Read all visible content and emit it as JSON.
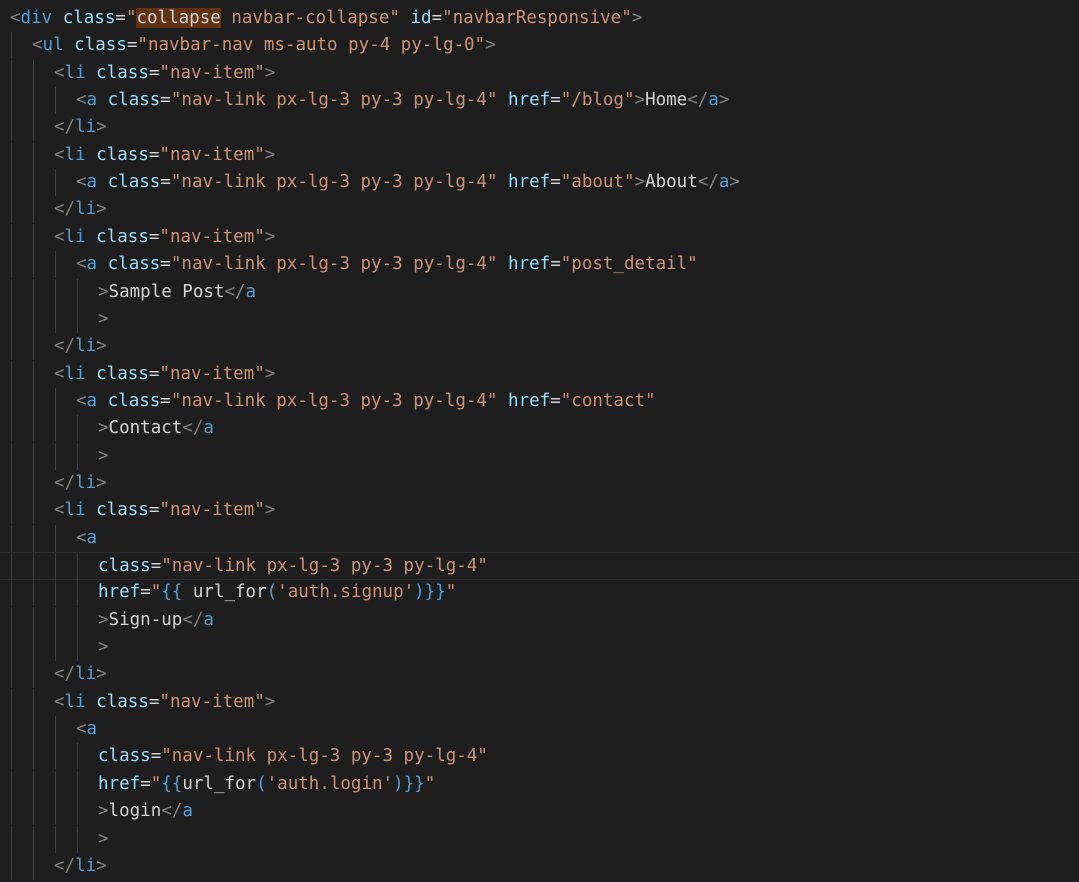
{
  "editor": {
    "language": "html",
    "theme": "dark",
    "lines": [
      {
        "indent": 0,
        "tokens": [
          [
            "b",
            "<"
          ],
          [
            "t",
            "div"
          ],
          [
            "tx",
            " "
          ],
          [
            "a",
            "class"
          ],
          [
            "tx",
            "="
          ],
          [
            "s",
            "\""
          ],
          [
            "sel",
            "collapse"
          ],
          [
            "s",
            " navbar-collapse\""
          ],
          [
            "tx",
            " "
          ],
          [
            "a",
            "id"
          ],
          [
            "tx",
            "="
          ],
          [
            "s",
            "\"navbarResponsive\""
          ],
          [
            "b",
            ">"
          ]
        ]
      },
      {
        "indent": 1,
        "tokens": [
          [
            "b",
            "<"
          ],
          [
            "t",
            "ul"
          ],
          [
            "tx",
            " "
          ],
          [
            "a",
            "class"
          ],
          [
            "tx",
            "="
          ],
          [
            "s",
            "\"navbar-nav ms-auto py-4 py-lg-0\""
          ],
          [
            "b",
            ">"
          ]
        ]
      },
      {
        "indent": 2,
        "tokens": [
          [
            "b",
            "<"
          ],
          [
            "t",
            "li"
          ],
          [
            "tx",
            " "
          ],
          [
            "a",
            "class"
          ],
          [
            "tx",
            "="
          ],
          [
            "s",
            "\"nav-item\""
          ],
          [
            "b",
            ">"
          ]
        ]
      },
      {
        "indent": 3,
        "tokens": [
          [
            "b",
            "<"
          ],
          [
            "t",
            "a"
          ],
          [
            "tx",
            " "
          ],
          [
            "a",
            "class"
          ],
          [
            "tx",
            "="
          ],
          [
            "s",
            "\"nav-link px-lg-3 py-3 py-lg-4\""
          ],
          [
            "tx",
            " "
          ],
          [
            "a",
            "href"
          ],
          [
            "tx",
            "="
          ],
          [
            "s",
            "\"/blog\""
          ],
          [
            "b",
            ">"
          ],
          [
            "tx",
            "Home"
          ],
          [
            "b",
            "</"
          ],
          [
            "t",
            "a"
          ],
          [
            "b",
            ">"
          ]
        ]
      },
      {
        "indent": 2,
        "tokens": [
          [
            "b",
            "</"
          ],
          [
            "t",
            "li"
          ],
          [
            "b",
            ">"
          ]
        ]
      },
      {
        "indent": 2,
        "tokens": [
          [
            "b",
            "<"
          ],
          [
            "t",
            "li"
          ],
          [
            "tx",
            " "
          ],
          [
            "a",
            "class"
          ],
          [
            "tx",
            "="
          ],
          [
            "s",
            "\"nav-item\""
          ],
          [
            "b",
            ">"
          ]
        ]
      },
      {
        "indent": 3,
        "tokens": [
          [
            "b",
            "<"
          ],
          [
            "t",
            "a"
          ],
          [
            "tx",
            " "
          ],
          [
            "a",
            "class"
          ],
          [
            "tx",
            "="
          ],
          [
            "s",
            "\"nav-link px-lg-3 py-3 py-lg-4\""
          ],
          [
            "tx",
            " "
          ],
          [
            "a",
            "href"
          ],
          [
            "tx",
            "="
          ],
          [
            "s",
            "\"about\""
          ],
          [
            "b",
            ">"
          ],
          [
            "tx",
            "About"
          ],
          [
            "b",
            "</"
          ],
          [
            "t",
            "a"
          ],
          [
            "b",
            ">"
          ]
        ]
      },
      {
        "indent": 2,
        "tokens": [
          [
            "b",
            "</"
          ],
          [
            "t",
            "li"
          ],
          [
            "b",
            ">"
          ]
        ]
      },
      {
        "indent": 2,
        "tokens": [
          [
            "b",
            "<"
          ],
          [
            "t",
            "li"
          ],
          [
            "tx",
            " "
          ],
          [
            "a",
            "class"
          ],
          [
            "tx",
            "="
          ],
          [
            "s",
            "\"nav-item\""
          ],
          [
            "b",
            ">"
          ]
        ]
      },
      {
        "indent": 3,
        "tokens": [
          [
            "b",
            "<"
          ],
          [
            "t",
            "a"
          ],
          [
            "tx",
            " "
          ],
          [
            "a",
            "class"
          ],
          [
            "tx",
            "="
          ],
          [
            "s",
            "\"nav-link px-lg-3 py-3 py-lg-4\""
          ],
          [
            "tx",
            " "
          ],
          [
            "a",
            "href"
          ],
          [
            "tx",
            "="
          ],
          [
            "s",
            "\"post_detail\""
          ]
        ]
      },
      {
        "indent": 4,
        "tokens": [
          [
            "b",
            ">"
          ],
          [
            "tx",
            "Sample Post"
          ],
          [
            "b",
            "</"
          ],
          [
            "t",
            "a"
          ]
        ]
      },
      {
        "indent": 4,
        "tokens": [
          [
            "b",
            ">"
          ]
        ]
      },
      {
        "indent": 2,
        "tokens": [
          [
            "b",
            "</"
          ],
          [
            "t",
            "li"
          ],
          [
            "b",
            ">"
          ]
        ]
      },
      {
        "indent": 2,
        "tokens": [
          [
            "b",
            "<"
          ],
          [
            "t",
            "li"
          ],
          [
            "tx",
            " "
          ],
          [
            "a",
            "class"
          ],
          [
            "tx",
            "="
          ],
          [
            "s",
            "\"nav-item\""
          ],
          [
            "b",
            ">"
          ]
        ]
      },
      {
        "indent": 3,
        "tokens": [
          [
            "b",
            "<"
          ],
          [
            "t",
            "a"
          ],
          [
            "tx",
            " "
          ],
          [
            "a",
            "class"
          ],
          [
            "tx",
            "="
          ],
          [
            "s",
            "\"nav-link px-lg-3 py-3 py-lg-4\""
          ],
          [
            "tx",
            " "
          ],
          [
            "a",
            "href"
          ],
          [
            "tx",
            "="
          ],
          [
            "s",
            "\"contact\""
          ]
        ]
      },
      {
        "indent": 4,
        "tokens": [
          [
            "b",
            ">"
          ],
          [
            "tx",
            "Contact"
          ],
          [
            "b",
            "</"
          ],
          [
            "t",
            "a"
          ]
        ]
      },
      {
        "indent": 4,
        "tokens": [
          [
            "b",
            ">"
          ]
        ]
      },
      {
        "indent": 2,
        "tokens": [
          [
            "b",
            "</"
          ],
          [
            "t",
            "li"
          ],
          [
            "b",
            ">"
          ]
        ]
      },
      {
        "indent": 2,
        "tokens": [
          [
            "b",
            "<"
          ],
          [
            "t",
            "li"
          ],
          [
            "tx",
            " "
          ],
          [
            "a",
            "class"
          ],
          [
            "tx",
            "="
          ],
          [
            "s",
            "\"nav-item\""
          ],
          [
            "b",
            ">"
          ]
        ]
      },
      {
        "indent": 3,
        "tokens": [
          [
            "b",
            "<"
          ],
          [
            "t",
            "a"
          ]
        ]
      },
      {
        "indent": 4,
        "tokens": [
          [
            "a",
            "class"
          ],
          [
            "tx",
            "="
          ],
          [
            "s",
            "\"nav-link px-lg-3 py-3 py-lg-4\""
          ]
        ],
        "current": true
      },
      {
        "indent": 4,
        "tokens": [
          [
            "a",
            "href"
          ],
          [
            "tx",
            "="
          ],
          [
            "s",
            "\""
          ],
          [
            "t",
            "{{ "
          ],
          [
            "tx",
            "url_for"
          ],
          [
            "t",
            "("
          ],
          [
            "s",
            "'auth.signup'"
          ],
          [
            "t",
            ")}}"
          ],
          [
            "s",
            "\""
          ]
        ]
      },
      {
        "indent": 4,
        "tokens": [
          [
            "b",
            ">"
          ],
          [
            "tx",
            "Sign-up"
          ],
          [
            "b",
            "</"
          ],
          [
            "t",
            "a"
          ]
        ]
      },
      {
        "indent": 4,
        "tokens": [
          [
            "b",
            ">"
          ]
        ]
      },
      {
        "indent": 2,
        "tokens": [
          [
            "b",
            "</"
          ],
          [
            "t",
            "li"
          ],
          [
            "b",
            ">"
          ]
        ]
      },
      {
        "indent": 2,
        "tokens": [
          [
            "b",
            "<"
          ],
          [
            "t",
            "li"
          ],
          [
            "tx",
            " "
          ],
          [
            "a",
            "class"
          ],
          [
            "tx",
            "="
          ],
          [
            "s",
            "\"nav-item\""
          ],
          [
            "b",
            ">"
          ]
        ]
      },
      {
        "indent": 3,
        "tokens": [
          [
            "b",
            "<"
          ],
          [
            "t",
            "a"
          ]
        ]
      },
      {
        "indent": 4,
        "tokens": [
          [
            "a",
            "class"
          ],
          [
            "tx",
            "="
          ],
          [
            "s",
            "\"nav-link px-lg-3 py-3 py-lg-4\""
          ]
        ]
      },
      {
        "indent": 4,
        "tokens": [
          [
            "a",
            "href"
          ],
          [
            "tx",
            "="
          ],
          [
            "s",
            "\""
          ],
          [
            "t",
            "{{"
          ],
          [
            "tx",
            "url_for"
          ],
          [
            "t",
            "("
          ],
          [
            "s",
            "'auth.login'"
          ],
          [
            "t",
            ")}}"
          ],
          [
            "s",
            "\""
          ]
        ]
      },
      {
        "indent": 4,
        "tokens": [
          [
            "b",
            ">"
          ],
          [
            "tx",
            "login"
          ],
          [
            "b",
            "</"
          ],
          [
            "t",
            "a"
          ]
        ]
      },
      {
        "indent": 4,
        "tokens": [
          [
            "b",
            ">"
          ]
        ]
      },
      {
        "indent": 2,
        "tokens": [
          [
            "b",
            "</"
          ],
          [
            "t",
            "li"
          ],
          [
            "b",
            ">"
          ]
        ]
      }
    ]
  }
}
